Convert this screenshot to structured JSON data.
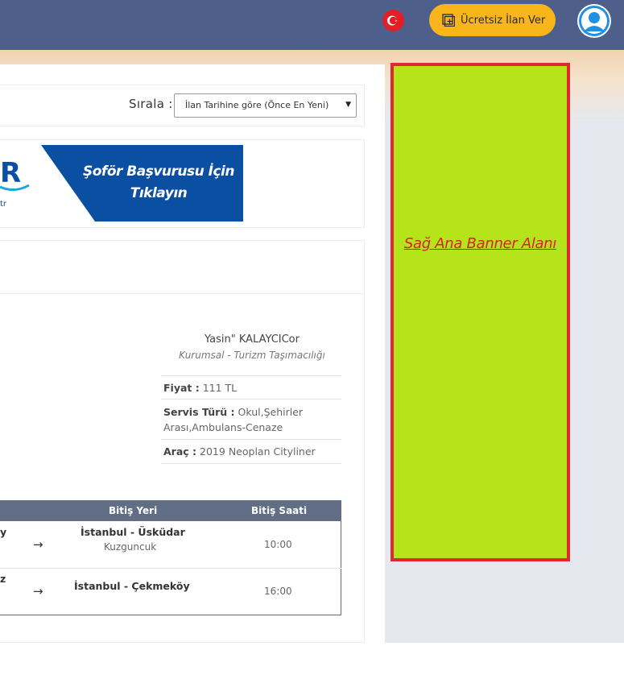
{
  "header": {
    "language_flag_icon": "turkey-flag-icon",
    "post_ad_button": "Ücretsiz İlan Ver",
    "post_ad_icon": "plus-square-icon",
    "avatar_icon": "user-avatar-icon"
  },
  "sort": {
    "label": "Sırala :",
    "selected": "İlan Tarihine göre (Önce En Yeni)"
  },
  "banner": {
    "line1": "Şoför Başvurusu İçin",
    "line2": "Tıklayın",
    "logo_partial": "R",
    "logo_tail": "tr"
  },
  "listing": {
    "company_name": "Yasin\" KALAYCICor",
    "company_type": "Kurumsal - Turizm Taşımacılığı",
    "price_label": "Fiyat :",
    "price_value": "111 TL",
    "service_label": "Servis Türü :",
    "service_value_1": "Okul,Şehirler",
    "service_value_2": "Arası,Ambulans-Cenaze",
    "vehicle_label": "Araç :",
    "vehicle_value": "2019  Neoplan  Cityliner"
  },
  "routes": {
    "headers": {
      "end_place": "Bitiş Yeri",
      "end_time": "Bitiş Saati"
    },
    "rows": [
      {
        "start_fragment": "y",
        "end_city": "İstanbul - Üsküdar",
        "end_district": "Kuzguncuk",
        "end_time": "10:00"
      },
      {
        "start_fragment": "z",
        "end_city": "İstanbul - Çekmeköy",
        "end_district": "",
        "end_time": "16:00"
      }
    ]
  },
  "right_banner": {
    "text": "Sağ Ana Banner Alanı",
    "bg_color": "#b6e41b",
    "border_color": "#e32630"
  },
  "colors": {
    "topbar": "#4e5f8c",
    "cta": "#f9b61b",
    "table_header": "#626d86"
  }
}
